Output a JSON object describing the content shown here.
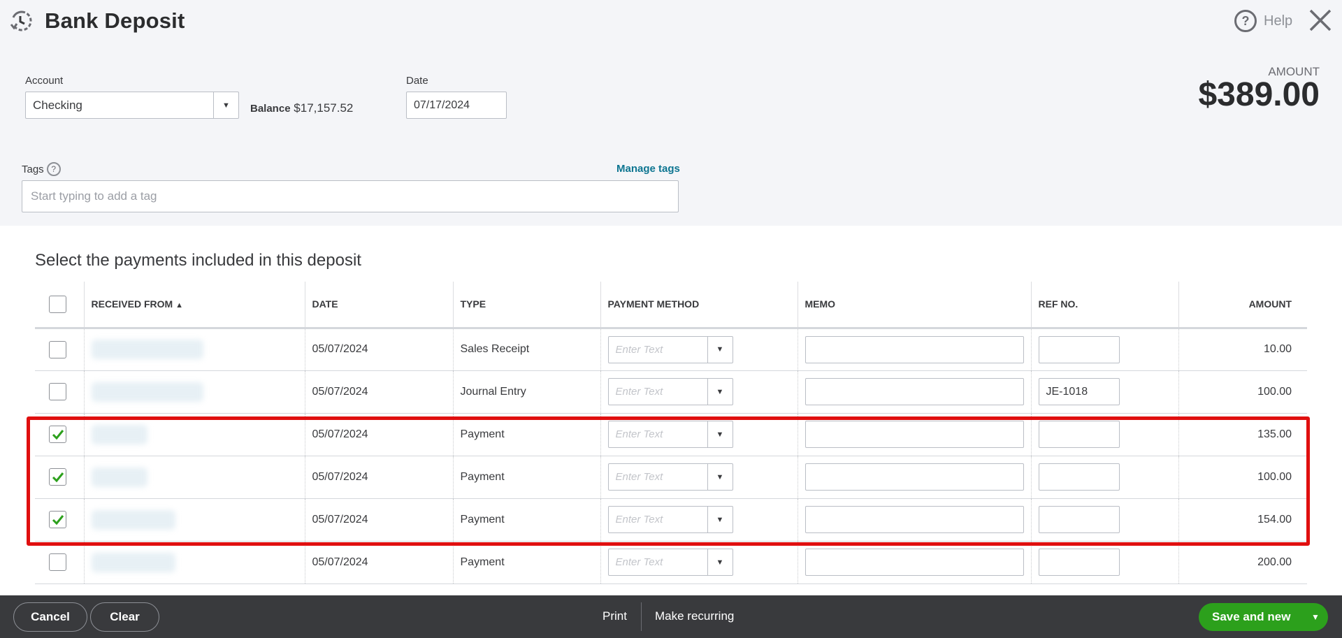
{
  "header": {
    "title": "Bank Deposit",
    "help_label": "Help",
    "help_icon": "question-circle-icon",
    "close_icon": "close-icon",
    "history_icon": "recent-history-icon"
  },
  "amount": {
    "label": "AMOUNT",
    "value": "$389.00"
  },
  "form": {
    "account_label": "Account",
    "account_value": "Checking",
    "balance_label": "Balance",
    "balance_value": "$17,157.52",
    "date_label": "Date",
    "date_value": "07/17/2024",
    "tags_label": "Tags",
    "manage_tags": "Manage tags",
    "tags_placeholder": "Start typing to add a tag"
  },
  "payments": {
    "title": "Select the payments included in this deposit",
    "columns": [
      "RECEIVED FROM",
      "DATE",
      "TYPE",
      "PAYMENT METHOD",
      "MEMO",
      "REF NO.",
      "AMOUNT"
    ],
    "sort_indicator": "▲",
    "payment_method_placeholder": "Enter Text",
    "rows": [
      {
        "checked": false,
        "date": "05/07/2024",
        "type": "Sales Receipt",
        "ref": "",
        "amount": "10.00"
      },
      {
        "checked": false,
        "date": "05/07/2024",
        "type": "Journal Entry",
        "ref": "JE-1018",
        "amount": "100.00"
      },
      {
        "checked": true,
        "date": "05/07/2024",
        "type": "Payment",
        "ref": "",
        "amount": "135.00"
      },
      {
        "checked": true,
        "date": "05/07/2024",
        "type": "Payment",
        "ref": "",
        "amount": "100.00"
      },
      {
        "checked": true,
        "date": "05/07/2024",
        "type": "Payment",
        "ref": "",
        "amount": "154.00"
      },
      {
        "checked": false,
        "date": "05/07/2024",
        "type": "Payment",
        "ref": "",
        "amount": "200.00"
      }
    ]
  },
  "footer": {
    "cancel": "Cancel",
    "clear": "Clear",
    "print": "Print",
    "make_recurring": "Make recurring",
    "save_and_new": "Save and new"
  },
  "colors": {
    "accent_green": "#2ca01c",
    "highlight_red": "#e00f0f",
    "link_teal": "#0d7591",
    "footer_bg": "#393a3d"
  }
}
